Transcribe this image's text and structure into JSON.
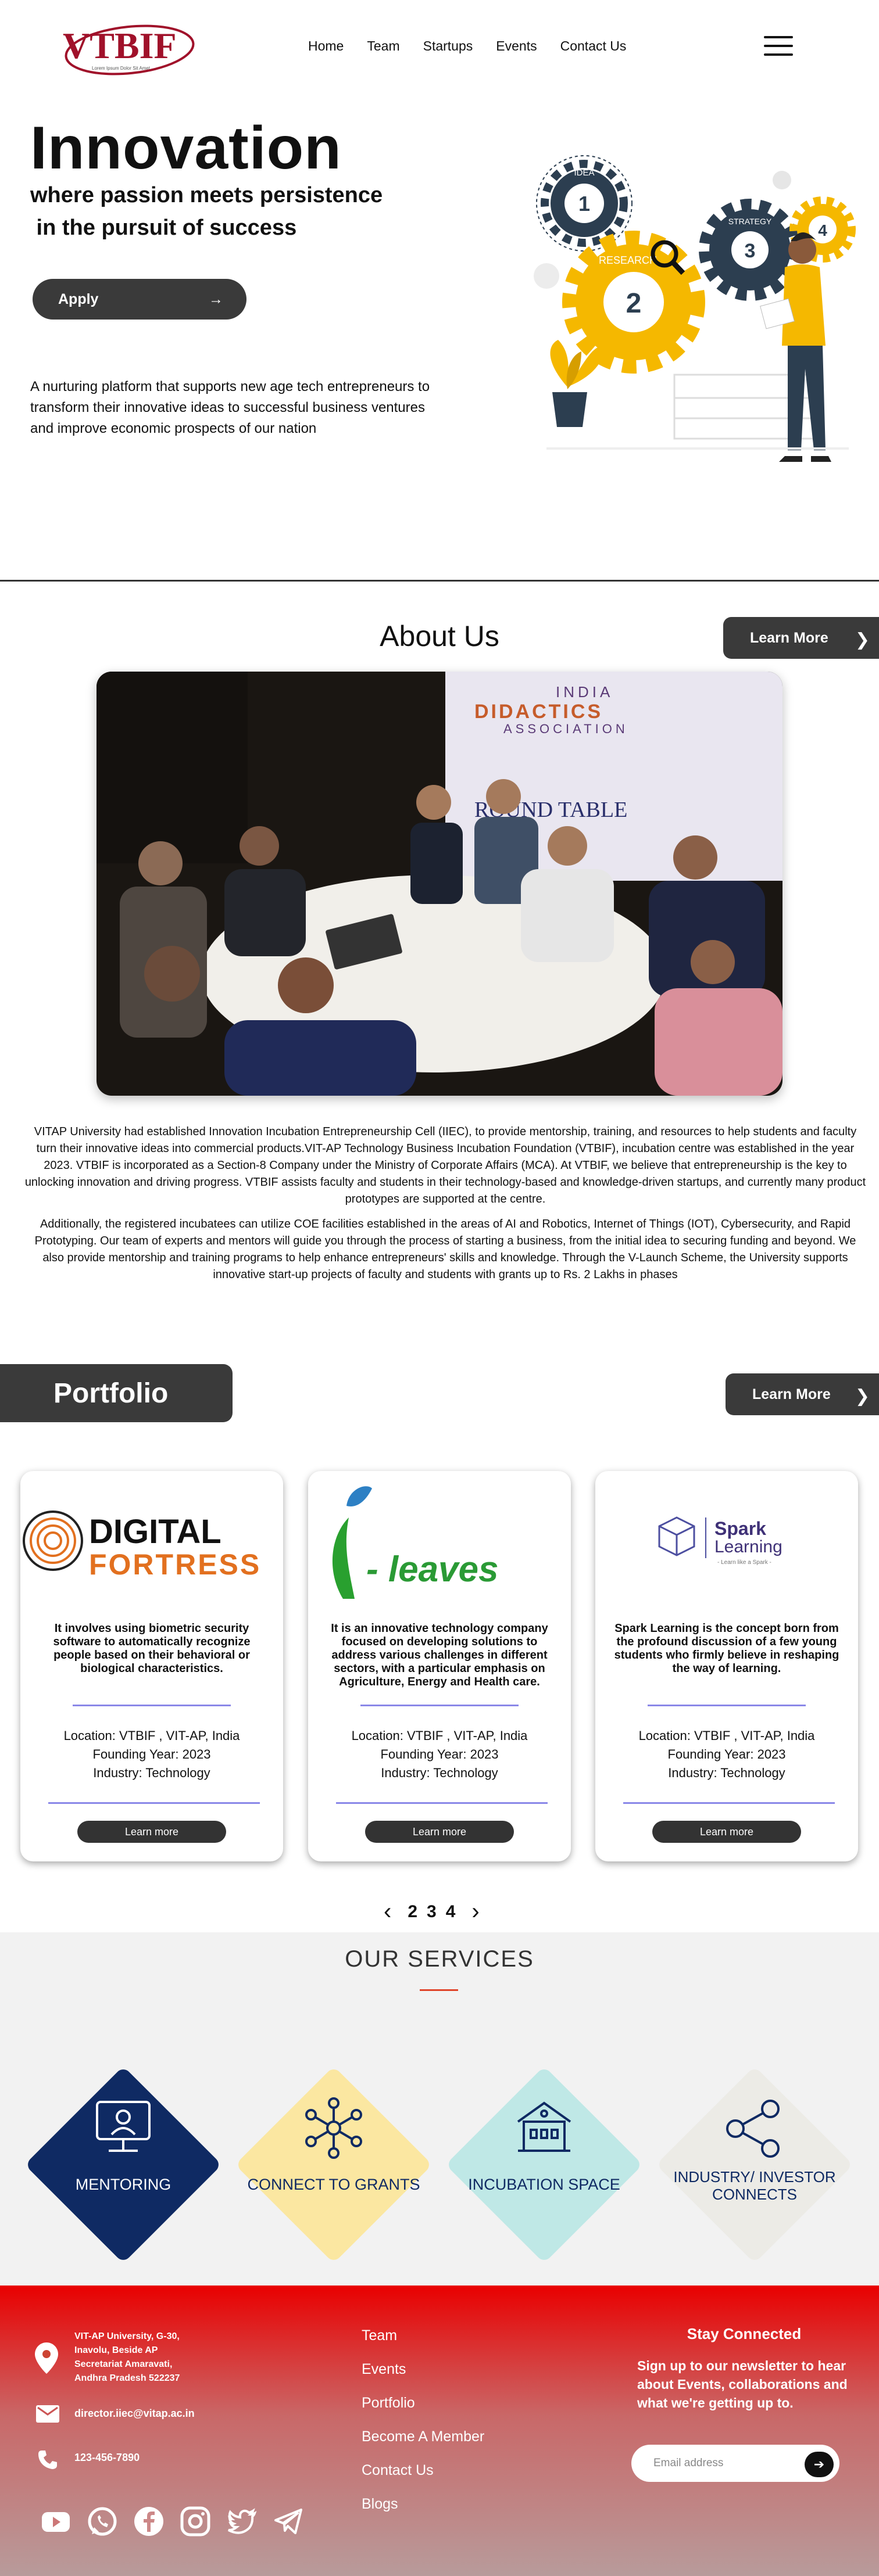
{
  "brand": {
    "logo_text": "VTBIF",
    "logo_tagline": "Lorem Ipsum Dolor Sit Amet"
  },
  "nav": {
    "items": [
      "Home",
      "Team",
      "Startups",
      "Events",
      "Contact Us"
    ]
  },
  "hero": {
    "title": "Innovation",
    "subtitle_line1": "where passion meets persistence",
    "subtitle_line2": " in the pursuit of success",
    "apply_label": "Apply",
    "apply_arrow": "→",
    "description": "A nurturing platform that supports new age tech entrepreneurs to transform their innovative ideas to successful business ventures and improve economic prospects of our nation",
    "art_labels": [
      "IDEA",
      "1",
      "RESEARCH",
      "2",
      "STRATEGY",
      "3",
      "4"
    ]
  },
  "about": {
    "title": "About Us",
    "learn_label": "Learn More",
    "photo_banner_line1": "INDIA",
    "photo_banner_line2": "DIDACTICS",
    "photo_banner_line3": "ASSOCIATION",
    "photo_banner_line4": "ROUND TABLE",
    "paragraph1": "VITAP University had established Innovation Incubation Entrepreneurship Cell (IIEC), to provide mentorship, training, and resources to help students and faculty turn their innovative ideas into commercial products.VIT-AP Technology Business Incubation Foundation (VTBIF), incubation centre was established in the year 2023. VTBIF is incorporated as a Section-8 Company under the Ministry of Corporate Affairs (MCA). At VTBIF, we believe that entrepreneurship is the key to unlocking innovation and driving progress. VTBIF assists faculty and students in their technology-based and knowledge-driven startups, and currently many product prototypes are supported at the centre.",
    "paragraph2": "Additionally, the registered incubatees can utilize COE facilities established in the areas of AI and Robotics, Internet of Things (IOT), Cybersecurity, and Rapid Prototyping. Our team of experts and mentors will guide you through the process of starting a business, from the initial idea to securing funding and beyond. We also provide mentorship and training programs to help enhance entrepreneurs' skills and knowledge. Through the V-Launch Scheme, the University supports innovative start-up projects of faculty and students with grants up to Rs. 2 Lakhs in phases"
  },
  "portfolio": {
    "title": "Portfolio",
    "learn_label": "Learn More",
    "cards": [
      {
        "logo_main": "DIGITAL",
        "logo_sub": "FORTRESS",
        "description": "It involves using biometric security software to automatically recognize people based on their behavioral or biological characteristics.",
        "location": "Location: VTBIF , VIT-AP, India",
        "year": "Founding Year: 2023",
        "industry": "Industry: Technology",
        "button": "Learn more"
      },
      {
        "logo_main": "i",
        "logo_sub": "- leaves",
        "description": "It is an innovative technology company focused on developing solutions to address various challenges in different sectors, with a particular emphasis on Agriculture, Energy and Health care.",
        "location": "Location: VTBIF , VIT-AP, India",
        "year": "Founding Year: 2023",
        "industry": "Industry: Technology",
        "button": "Learn more"
      },
      {
        "logo_main": "Spark",
        "logo_sub": "Learning",
        "logo_tag": "- Learn like a Spark -",
        "description": "Spark Learning is the concept born from the profound discussion of a few young students who firmly believe in reshaping the way of learning.",
        "location": "Location: VTBIF , VIT-AP, India",
        "year": "Founding Year: 2023",
        "industry": "Industry: Technology",
        "button": "Learn more"
      }
    ],
    "pager": {
      "prev": "‹",
      "pages": [
        "2",
        "3",
        "4"
      ],
      "next": "›"
    }
  },
  "services": {
    "title": "OUR SERVICES",
    "items": [
      {
        "label": "MENTORING",
        "icon": "mentor-icon",
        "color": "#0f2a63",
        "text_color": "#ffffff"
      },
      {
        "label": "CONNECT TO GRANTS",
        "icon": "network-icon",
        "color": "#fbe7a1",
        "text_color": "#0f2a63"
      },
      {
        "label": "INCUBATION SPACE",
        "icon": "building-icon",
        "color": "#bfe8e6",
        "text_color": "#0f2a63"
      },
      {
        "label": "INDUSTRY/ INVESTOR CONNECTS",
        "icon": "share-icon",
        "color": "#ecebe6",
        "text_color": "#0f2a63"
      }
    ]
  },
  "footer": {
    "address": [
      "VIT-AP University, G-30,",
      "Inavolu, Beside AP",
      "Secretariat Amaravati,",
      "Andhra Pradesh 522237"
    ],
    "email": "director.iiec@vitap.ac.in",
    "phone": "123-456-7890",
    "links": [
      "Team",
      "Events",
      "Portfolio",
      "Become A Member",
      "Contact Us",
      "Blogs"
    ],
    "stay_title": "Stay Connected",
    "stay_text": "Sign up to our newsletter to hear about Events, collaborations and what we're getting up to.",
    "email_placeholder": "Email address",
    "social": [
      "youtube-icon",
      "whatsapp-icon",
      "facebook-icon",
      "instagram-icon",
      "twitter-icon",
      "telegram-icon"
    ]
  }
}
